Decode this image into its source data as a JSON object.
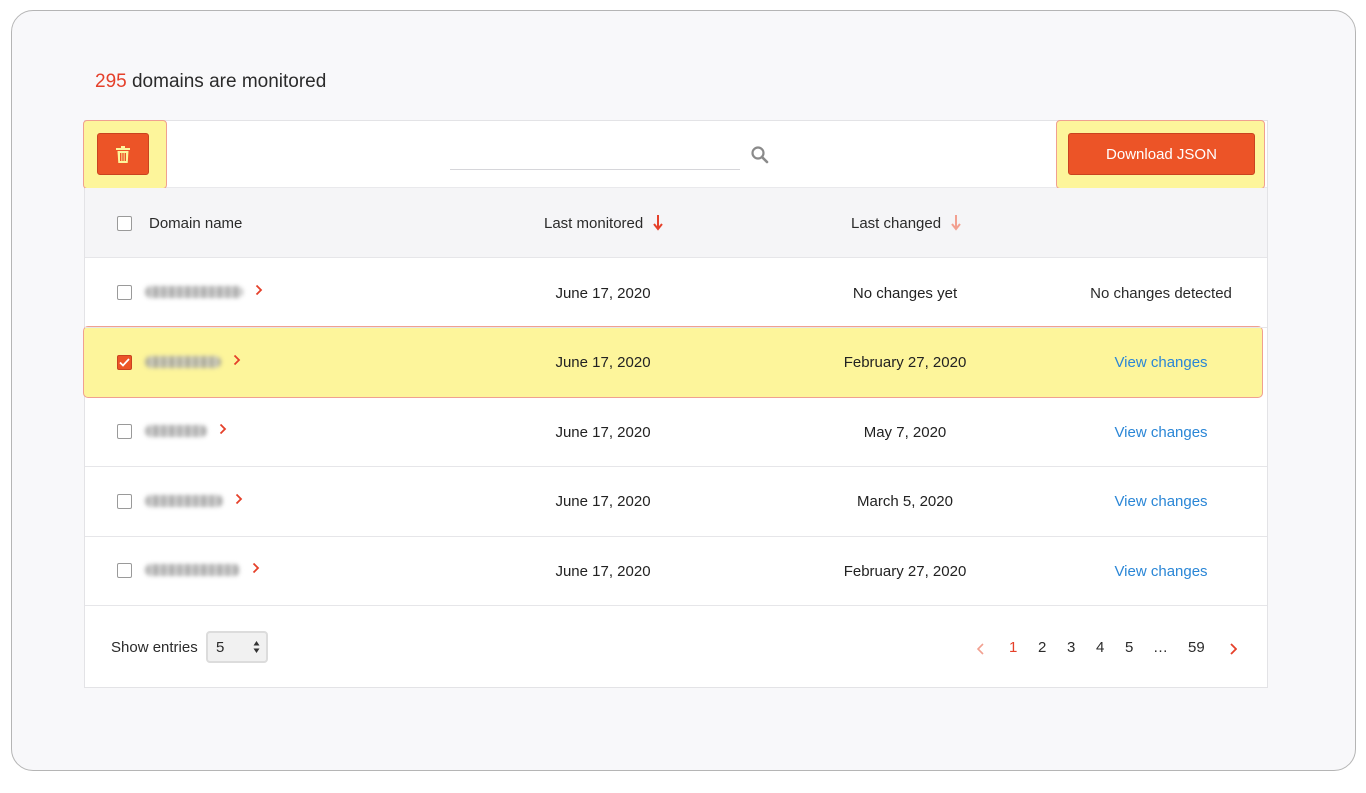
{
  "summary": {
    "count": "295",
    "text": " domains are monitored"
  },
  "toolbar": {
    "download_label": "Download JSON",
    "search_placeholder": "",
    "search_value": ""
  },
  "table": {
    "headers": {
      "domain": "Domain name",
      "last_monitored": "Last monitored",
      "last_changed": "Last changed"
    },
    "rows": [
      {
        "last_monitored": "June 17, 2020",
        "last_changed": "No changes yet",
        "action": "No changes detected",
        "action_link": false,
        "checked": false
      },
      {
        "last_monitored": "June 17, 2020",
        "last_changed": "February 27, 2020",
        "action": "View changes",
        "action_link": true,
        "checked": true
      },
      {
        "last_monitored": "June 17, 2020",
        "last_changed": "May 7, 2020",
        "action": "View changes",
        "action_link": true,
        "checked": false
      },
      {
        "last_monitored": "June 17, 2020",
        "last_changed": "March 5, 2020",
        "action": "View changes",
        "action_link": true,
        "checked": false
      },
      {
        "last_monitored": "June 17, 2020",
        "last_changed": "February 27, 2020",
        "action": "View changes",
        "action_link": true,
        "checked": false
      }
    ]
  },
  "footer": {
    "show_entries_label": "Show entries",
    "entries_value": "5",
    "pagination": {
      "pages": [
        "1",
        "2",
        "3",
        "4",
        "5",
        "…",
        "59"
      ],
      "current": "1"
    }
  },
  "colors": {
    "accent": "#ec5427",
    "highlight": "#fdf59b",
    "link": "#2a86d6",
    "count": "#e5402a"
  },
  "icons": {
    "delete": "trash-icon",
    "search": "search-icon",
    "row_expand": "chevron-right-icon",
    "prev": "chevron-left-icon",
    "next": "chevron-right-icon"
  }
}
